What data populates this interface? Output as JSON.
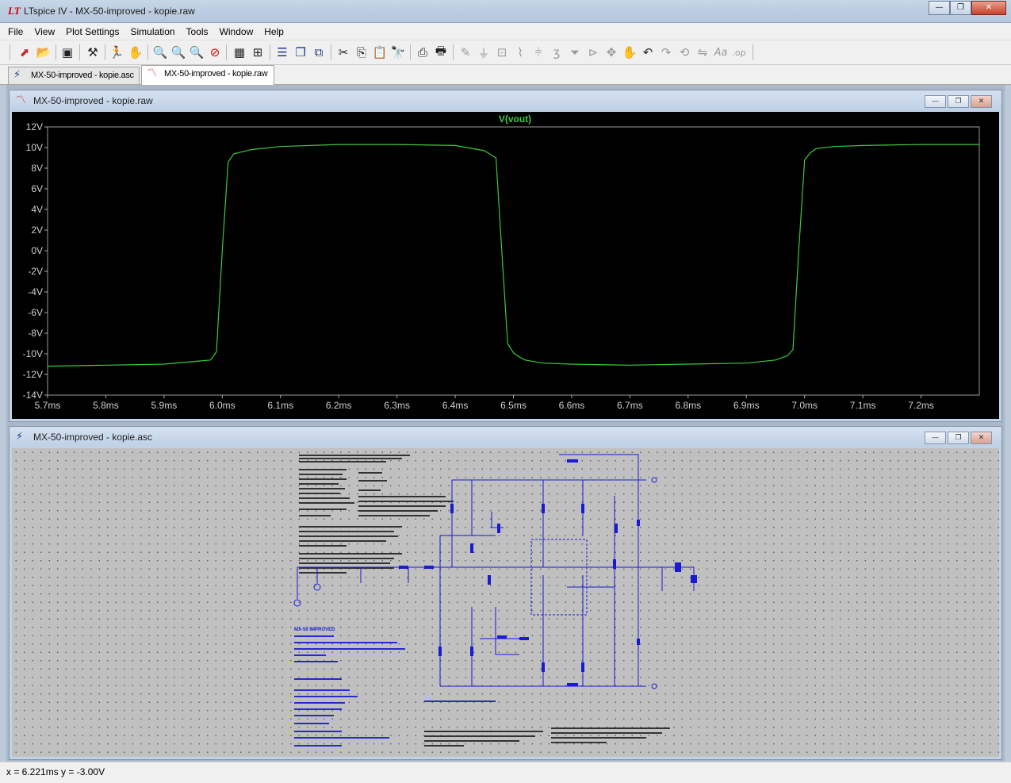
{
  "app": {
    "title": "LTspice IV - MX-50-improved - kopie.raw",
    "logo": "LT"
  },
  "window_controls": {
    "minimize": "—",
    "maximize": "❐",
    "close": "✕"
  },
  "menu": [
    "File",
    "View",
    "Plot Settings",
    "Simulation",
    "Tools",
    "Window",
    "Help"
  ],
  "toolbar_icons": [
    "new-schematic",
    "open-folder",
    "save",
    "control-panel",
    "run",
    "halt",
    "zoom-in",
    "zoom-pan",
    "zoom-out",
    "zoom-cancel",
    "autorange",
    "axis-settings",
    "tile-horizontal",
    "cascade",
    "tile-vertical",
    "cut",
    "copy",
    "paste",
    "find",
    "print-preview",
    "print",
    "draw-wire",
    "ground",
    "label-net",
    "resistor",
    "capacitor",
    "inductor",
    "diode",
    "component",
    "move",
    "drag",
    "undo",
    "redo",
    "rotate",
    "mirror",
    "text",
    "spice-directive"
  ],
  "tabs": [
    {
      "label": "MX-50-improved - kopie.asc",
      "icon": "schematic-icon"
    },
    {
      "label": "MX-50-improved - kopie.raw",
      "icon": "waveform-icon"
    }
  ],
  "waveform_window": {
    "title": "MX-50-improved - kopie.raw",
    "trace_color": "#3ec93e"
  },
  "schematic_window": {
    "title": "MX-50-improved - kopie.asc",
    "heading": "MX-50 IMPROVED",
    "wire_color": "#2222cc"
  },
  "status": {
    "text": "x = 6.221ms    y = -3.00V"
  },
  "chart_data": {
    "type": "line",
    "title": "V(vout)",
    "xlim": [
      5.7,
      7.3
    ],
    "ylim": [
      -14,
      12
    ],
    "x_ticks": [
      "5.7ms",
      "5.8ms",
      "5.9ms",
      "6.0ms",
      "6.1ms",
      "6.2ms",
      "6.3ms",
      "6.4ms",
      "6.5ms",
      "6.6ms",
      "6.7ms",
      "6.8ms",
      "6.9ms",
      "7.0ms",
      "7.1ms",
      "7.2ms"
    ],
    "y_ticks": [
      "12V",
      "10V",
      "8V",
      "6V",
      "4V",
      "2V",
      "0V",
      "-2V",
      "-4V",
      "-6V",
      "-8V",
      "-10V",
      "-12V",
      "-14V"
    ],
    "series": [
      {
        "name": "V(vout)",
        "x": [
          5.7,
          5.8,
          5.9,
          5.98,
          5.99,
          6.0,
          6.01,
          6.02,
          6.05,
          6.1,
          6.2,
          6.3,
          6.4,
          6.45,
          6.47,
          6.48,
          6.49,
          6.5,
          6.51,
          6.52,
          6.55,
          6.6,
          6.7,
          6.8,
          6.9,
          6.95,
          6.97,
          6.98,
          6.99,
          7.0,
          7.01,
          7.02,
          7.05,
          7.1,
          7.2,
          7.3
        ],
        "y": [
          -11.2,
          -11.1,
          -11.0,
          -10.6,
          -9.8,
          0.0,
          8.6,
          9.4,
          9.8,
          10.1,
          10.3,
          10.3,
          10.2,
          9.7,
          9.0,
          0.0,
          -9.0,
          -9.9,
          -10.3,
          -10.6,
          -10.9,
          -11.0,
          -11.1,
          -11.0,
          -10.9,
          -10.6,
          -10.2,
          -9.6,
          0.0,
          8.8,
          9.5,
          9.9,
          10.1,
          10.2,
          10.3,
          10.3
        ]
      }
    ]
  }
}
